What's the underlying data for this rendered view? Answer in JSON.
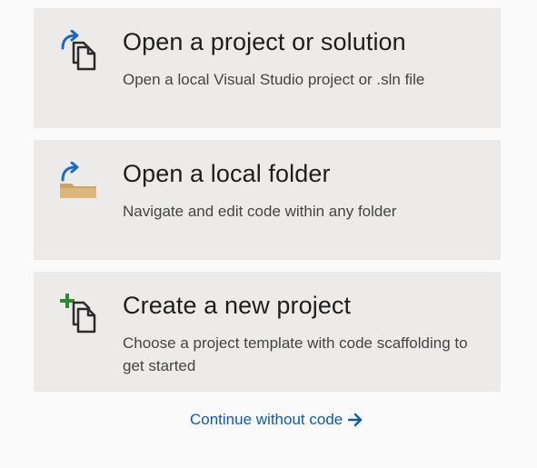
{
  "cards": [
    {
      "title": "Open a project or solution",
      "description": "Open a local Visual Studio project or .sln file",
      "icon": "open-project-icon"
    },
    {
      "title": "Open a local folder",
      "description": "Navigate and edit code within any folder",
      "icon": "open-folder-icon"
    },
    {
      "title": "Create a new project",
      "description": "Choose a project template with code scaffolding to get started",
      "icon": "new-project-icon"
    }
  ],
  "continue_link": {
    "label": "Continue without code",
    "icon": "arrow-right-icon"
  },
  "colors": {
    "card_bg": "#ecebea",
    "page_bg": "#fafafa",
    "link": "#0e5ca8",
    "accent_blue": "#1b6ac0",
    "accent_green": "#2d8a2d",
    "folder": "#dcb67a"
  }
}
